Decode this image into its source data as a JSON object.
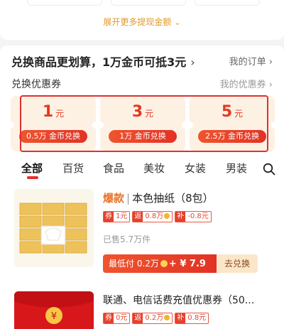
{
  "top": {
    "expand_label": "展开更多提现金额"
  },
  "exchange": {
    "title": "兑换商品更划算，1万金币可抵3元",
    "title_arrow": "›",
    "my_orders": "我的订单 ›",
    "coupon_label": "兑换优惠券",
    "my_coupons": "我的优惠券 ›",
    "coupons": [
      {
        "amount": "1",
        "unit": "元",
        "button": "0.5万 金币兑换"
      },
      {
        "amount": "3",
        "unit": "元",
        "button": "1万 金币兑换"
      },
      {
        "amount": "5",
        "unit": "元",
        "button": "2.5万 金币兑换"
      }
    ]
  },
  "tabs": [
    "全部",
    "百货",
    "食品",
    "美妆",
    "女装",
    "男装"
  ],
  "products": [
    {
      "hot": "爆款",
      "sep": "|",
      "name": "本色抽纸（8包）",
      "tags": [
        {
          "k": "券",
          "v": "1元"
        },
        {
          "k": "返",
          "v": "0.8万"
        },
        {
          "k": "补",
          "v": "-0.8元"
        }
      ],
      "sold": "已售5.7万件",
      "price_prefix": "最低付 0.2万",
      "price_yuan": "+ ¥ 7.9",
      "action": "去兑换"
    },
    {
      "name": "联通、电信话费充值优惠券（50...",
      "tags": [
        {
          "k": "券",
          "v": "0元"
        },
        {
          "k": "返",
          "v": "0.2万"
        },
        {
          "k": "补",
          "v": "0.8元"
        }
      ]
    }
  ],
  "colors": {
    "accent_red": "#e23224",
    "highlight_border": "#e03030",
    "coupon_bg": "#fdf1e4",
    "gold": "#e29a2c"
  }
}
